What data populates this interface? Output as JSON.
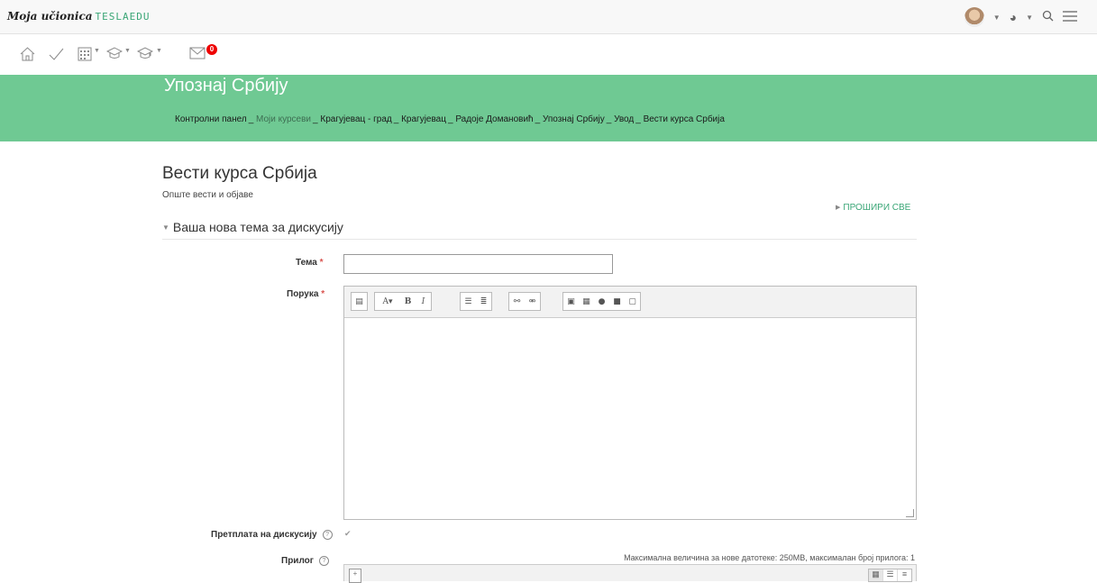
{
  "topbar": {
    "logo_text": "Moja učionica",
    "brand_text": "TESLAEDU"
  },
  "nav_icons": [
    "home-icon",
    "checkmark-icon",
    "calendar-icon",
    "graduation-cap-icon",
    "graduation-cap-alt-icon",
    "mail-icon"
  ],
  "messages_badge": "0",
  "header": {
    "course_title": "Упознај Србију",
    "breadcrumbs": [
      "Контролни панел",
      "Моји курсеви",
      "Крагујевац - град",
      "Крагујевац",
      "Радоје Домановић",
      "Упознај Србију",
      "Увод",
      "Вести курса Србија"
    ]
  },
  "page": {
    "title": "Вести курса Србија",
    "subtitle": "Опште вести и објаве",
    "expand_all": "ПРОШИРИ СВЕ",
    "section_title": "Ваша нова тема за дискусију"
  },
  "form": {
    "topic_label": "Тема",
    "topic_value": "",
    "message_label": "Порука",
    "required_mark": "*",
    "subscription_label": "Претплата на дискусију",
    "attachment_label": "Прилог",
    "attachment_note": "Максимална величина за нове датотеке: 250MB, максималан број прилога: 1"
  },
  "colors": {
    "header_bg": "#6fc993",
    "accent": "#3aa676",
    "required": "#d9534f",
    "badge": "#ee0000"
  }
}
